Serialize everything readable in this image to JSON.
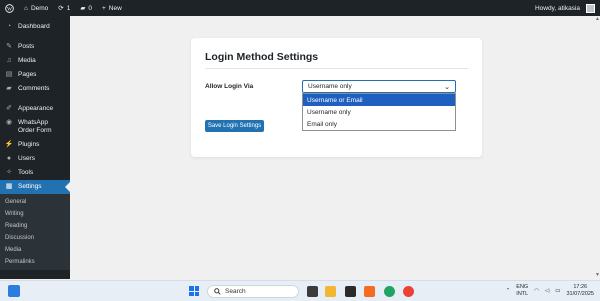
{
  "admin_bar": {
    "site_name": "Demo",
    "updates_count": "1",
    "comments_count": "0",
    "new_label": "New",
    "howdy": "Howdy, atikasia"
  },
  "sidebar": {
    "items": [
      {
        "label": "Dashboard",
        "icon": "dashboard-icon"
      },
      {
        "label": "Posts",
        "icon": "pin-icon"
      },
      {
        "label": "Media",
        "icon": "media-icon"
      },
      {
        "label": "Pages",
        "icon": "pages-icon"
      },
      {
        "label": "Comments",
        "icon": "comment-icon"
      },
      {
        "label": "Appearance",
        "icon": "brush-icon"
      },
      {
        "label": "WhatsApp Order Form",
        "icon": "whatsapp-icon"
      },
      {
        "label": "Plugins",
        "icon": "plugin-icon"
      },
      {
        "label": "Users",
        "icon": "users-icon"
      },
      {
        "label": "Tools",
        "icon": "wrench-icon"
      },
      {
        "label": "Settings",
        "icon": "settings-icon"
      }
    ],
    "submenu": [
      "General",
      "Writing",
      "Reading",
      "Discussion",
      "Media",
      "Permalinks"
    ]
  },
  "card": {
    "title": "Login Method Settings",
    "field_label": "Allow Login Via",
    "select_value": "Username only",
    "options": [
      "Username or Email",
      "Username only",
      "Email only"
    ],
    "highlighted_option": "Username or Email",
    "save_button": "Save Login Settings"
  },
  "taskbar": {
    "search_label": "Search",
    "lang_top": "ENG",
    "lang_bottom": "INTL",
    "time": "17:26",
    "date": "31/07/2025"
  },
  "colors": {
    "admin_dark": "#1d2327",
    "accent": "#2271b1",
    "highlight_option": "#1f5fbf",
    "background": "#f0f0f1"
  }
}
